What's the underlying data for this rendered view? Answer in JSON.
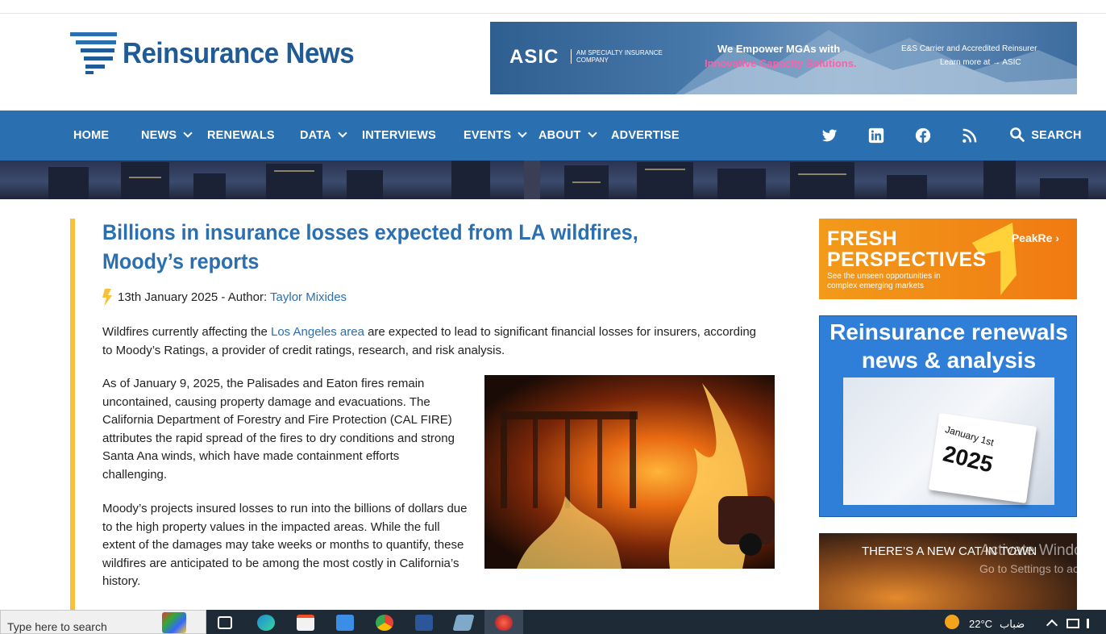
{
  "site": {
    "logo_text": "Reinsurance News"
  },
  "top_ad": {
    "brand": "ASIC",
    "brand_sub": "AM SPECIALTY INSURANCE COMPANY",
    "headline": "We Empower MGAs with",
    "headline2": "Innovative Capacity Solutions.",
    "right_line1": "E&S Carrier and Accredited Reinsurer",
    "right_line2": "Learn more at → ASIC"
  },
  "nav": {
    "items": [
      {
        "label": "HOME",
        "has_dropdown": false
      },
      {
        "label": "NEWS",
        "has_dropdown": true
      },
      {
        "label": "RENEWALS",
        "has_dropdown": false
      },
      {
        "label": "DATA",
        "has_dropdown": true
      },
      {
        "label": "INTERVIEWS",
        "has_dropdown": false
      },
      {
        "label": "EVENTS",
        "has_dropdown": true
      },
      {
        "label": "ABOUT",
        "has_dropdown": true
      },
      {
        "label": "ADVERTISE",
        "has_dropdown": false
      }
    ],
    "social_icons": [
      "twitter-icon",
      "linkedin-icon",
      "facebook-icon",
      "rss-icon"
    ],
    "search_label": "SEARCH",
    "color": "#2a6fb0"
  },
  "article": {
    "title": "Billions in insurance losses expected from LA wildfires, Moody’s reports",
    "date": "13th January 2025",
    "author_prefix": " - Author: ",
    "author": "Taylor Mixides",
    "p1_before": "Wildfires currently affecting the ",
    "p1_link": "Los Angeles area",
    "p1_after": " are expected to lead to significant financial losses for insurers, according to Moody’s Ratings, a provider of credit ratings, research, and risk analysis.",
    "p2": "As of January 9, 2025, the Palisades and Eaton fires remain uncontained, causing property damage and evacuations. The California Department of Forestry and Fire Protection (CAL FIRE) attributes the rapid spread of the fires to dry conditions and strong Santa Ana winds, which have made containment efforts challenging.",
    "p3": "Moody’s projects insured losses to run into the billions of dollars due to the high property values in the impacted areas. While the full extent of the damages may take weeks or months to quantify, these wildfires are anticipated to be among the most costly in California’s history.",
    "accent_color": "#f6c23b"
  },
  "sidebar": {
    "ad1_title": "FRESH PERSPECTIVES",
    "ad1_sub": "See the unseen opportunities in complex emerging markets",
    "ad1_brand": "PeakRe ›",
    "ad2_title": "Reinsurance renewals news & analysis",
    "ad2_cal_month": "January 1st",
    "ad2_cal_year": "2025",
    "ad3_title": "THERE’S A NEW CAT IN TOWN"
  },
  "os": {
    "watermark_line1": "Activate Windows",
    "watermark_line2": "Go to Settings to activate",
    "search_placeholder": "Type here to search",
    "temperature": "22°C",
    "weather": "ضباب"
  }
}
